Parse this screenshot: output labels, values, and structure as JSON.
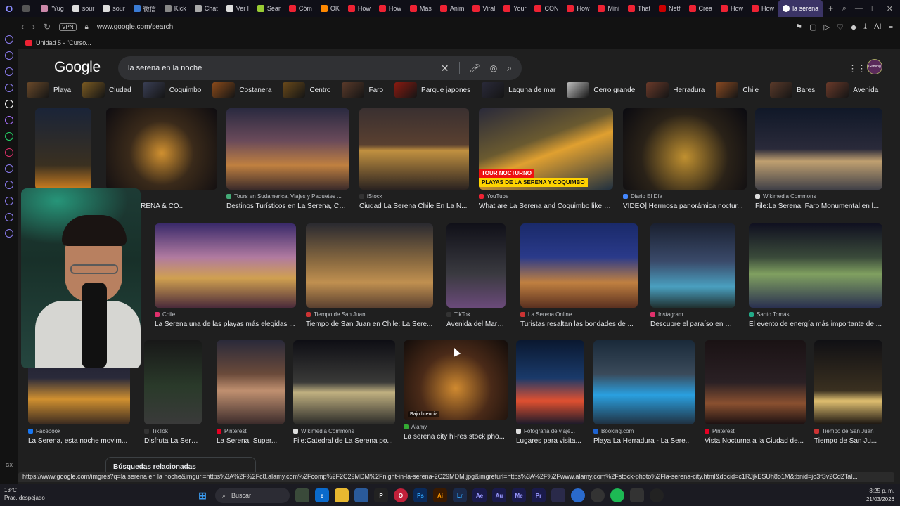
{
  "tabs": [
    {
      "label": "",
      "color": "#555"
    },
    {
      "label": "\"Yug",
      "color": "#c8a"
    },
    {
      "label": "sour",
      "color": "#ddd"
    },
    {
      "label": "sour",
      "color": "#ddd"
    },
    {
      "label": "微信",
      "color": "#3a7bd5"
    },
    {
      "label": "Kick",
      "color": "#888"
    },
    {
      "label": "Chat",
      "color": "#aaa"
    },
    {
      "label": "Ver l",
      "color": "#ddd"
    },
    {
      "label": "Sear",
      "color": "#9c3"
    },
    {
      "label": "Cóm",
      "color": "#e23"
    },
    {
      "label": "OK",
      "color": "#f80"
    },
    {
      "label": "How",
      "color": "#e23"
    },
    {
      "label": "How",
      "color": "#e23"
    },
    {
      "label": "Mas",
      "color": "#e23"
    },
    {
      "label": "Anim",
      "color": "#e23"
    },
    {
      "label": "Viral",
      "color": "#e23"
    },
    {
      "label": "Your",
      "color": "#e23"
    },
    {
      "label": "CON",
      "color": "#e23"
    },
    {
      "label": "How",
      "color": "#e23"
    },
    {
      "label": "Mini",
      "color": "#e23"
    },
    {
      "label": "That",
      "color": "#e23"
    },
    {
      "label": "Netf",
      "color": "#c00"
    },
    {
      "label": "Crea",
      "color": "#e23"
    },
    {
      "label": "How",
      "color": "#e23"
    },
    {
      "label": "How",
      "color": "#e23"
    }
  ],
  "active_tab": "la serena",
  "address": {
    "vpn": "VPN",
    "url": "www.google.com/search"
  },
  "bookmark": "Unidad 5 - \"Curso...",
  "search": {
    "logo": "Google",
    "query": "la serena en la noche"
  },
  "avatar_text": "Gaming",
  "chips": [
    {
      "label": "Playa",
      "color": "#6b4a2a"
    },
    {
      "label": "Ciudad",
      "color": "#7a5a22"
    },
    {
      "label": "Coquimbo",
      "color": "#3a3f55"
    },
    {
      "label": "Costanera",
      "color": "#8a4a1a"
    },
    {
      "label": "Centro",
      "color": "#6a4a1a"
    },
    {
      "label": "Faro",
      "color": "#5a3a2a"
    },
    {
      "label": "Parque japones",
      "color": "#8a1a10"
    },
    {
      "label": "Laguna de mar",
      "color": "#2a2a3a"
    },
    {
      "label": "Cerro grande",
      "color": "#c0c0c0"
    },
    {
      "label": "Herradura",
      "color": "#6a3a2a"
    },
    {
      "label": "Chile",
      "color": "#8a4a22"
    },
    {
      "label": "Bares",
      "color": "#5a3a2a"
    },
    {
      "label": "Avenida",
      "color": "#6a3a2a"
    }
  ],
  "results": [
    {
      "source": "",
      "title": "",
      "bg": "linear-gradient(180deg,#1a2438,#3a3020 70%,#d08020)"
    },
    {
      "source": "ture.com",
      "title": "ON \"LA SERENA & CO...",
      "bg": "radial-gradient(circle at 50% 55%,#d09030 0%,#3a2a1a 45%,#0e0c10 100%)"
    },
    {
      "source": "Tours en Sudamerica, Viajes y Paquetes ...",
      "title": "Destinos Turísticos en La Serena, Chile",
      "bg": "linear-gradient(180deg,#2a2a40,#6a4a5a 40%,#c08040 70%,#3a2a2a)"
    },
    {
      "source": "iStock",
      "title": "Ciudad La Serena Chile En La N...",
      "bg": "linear-gradient(180deg,#3a3030,#5a4030 45%,#c09040 52%,#2a2220)"
    },
    {
      "source": "YouTube",
      "title": "What are La Serena and Coquimbo like a...",
      "bg": "linear-gradient(160deg,#2a2a3a,#6a5a30 40%,#e0a030 55%,#203040)"
    },
    {
      "source": "Diario El Día",
      "title": "VIDEO] Hermosa panorámica noctur...",
      "bg": "radial-gradient(circle at 50% 60%,#c09030 0%,#2a2218 55%,#0a0a10 100%)"
    },
    {
      "source": "Wikimedia Commons",
      "title": "File:La Serena, Faro Monumental en l...",
      "bg": "linear-gradient(180deg,#101828,#2a2a3a 50%,#c0a070 65%,#404048)"
    },
    {
      "source": "Chile",
      "title": "La Serena una de las playas más elegidas ...",
      "bg": "linear-gradient(180deg,#3a2a6a,#b07aa0 40%,#d0a050 65%,#4a2a3a)"
    },
    {
      "source": "Tiempo de San Juan",
      "title": "Tiempo de San Juan en Chile: La Sere...",
      "bg": "linear-gradient(180deg,#2a2a30,#8a6a40 45%,#c09050 70%,#5a4030)"
    },
    {
      "source": "TikTok",
      "title": "Avenida del Mar: U...",
      "bg": "linear-gradient(180deg,#101018,#3a3a40 60%,#6a4a7a)"
    },
    {
      "source": "La Serena Online",
      "title": "Turistas resaltan las bondades de ...",
      "bg": "linear-gradient(180deg,#1a2a6a,#2a3a8a 40%,#c08040 70%,#5a3020)"
    },
    {
      "source": "Instagram",
      "title": "Descubre el paraíso en La ...",
      "bg": "linear-gradient(180deg,#1a2030,#3a4a6a 45%,#4aa0c0 75%,#203030)"
    },
    {
      "source": "Santo Tomás",
      "title": "El evento de energía más importante de ...",
      "bg": "linear-gradient(180deg,#101020,#3a4a3a 40%,#80a060 60%,#2a3050)"
    },
    {
      "source": "Facebook",
      "title": "La Serena, esta noche movim...",
      "bg": "linear-gradient(180deg,#1a1a2a,#2a2a3a 45%,#d09030 70%,#3a2a20)"
    },
    {
      "source": "TikTok",
      "title": "Disfruta La Serena...",
      "bg": "linear-gradient(180deg,#181818,#2a3a2a 55%,#3a3a3a)"
    },
    {
      "source": "Pinterest",
      "title": "La Serena, Super...",
      "bg": "linear-gradient(180deg,#2a2a3a,#6a4a3a 40%,#c09070 60%,#3a2a2a)"
    },
    {
      "source": "Wikimedia Commons",
      "title": "File:Catedral de La Serena po...",
      "bg": "linear-gradient(180deg,#0e0e14,#3a3a38 50%,#c0b080 62%,#2a2a28)"
    },
    {
      "source": "Alamy",
      "title": "La serena city hi-res stock pho...",
      "bg": "radial-gradient(circle at 50% 60%,#d08a30 0%,#4a2a18 50%,#120c0a 100%)"
    },
    {
      "source": "Fotografía de viaje...",
      "title": "Lugares para visita...",
      "bg": "linear-gradient(180deg,#0a1830,#1a3a6a 45%,#e05030 72%,#1a1a2a)"
    },
    {
      "source": "Booking.com",
      "title": "Playa La Herradura - La Sere...",
      "bg": "linear-gradient(180deg,#1a2a3a,#3a4a5a 40%,#2aa0e0 65%,#203040)"
    },
    {
      "source": "Pinterest",
      "title": "Vista Nocturna a la Ciudad de...",
      "bg": "linear-gradient(180deg,#1a1214,#2a2024 50%,#8a5030 75%,#1a1012)"
    },
    {
      "source": "Tiempo de San Juan",
      "title": "Tiempo de San Ju...",
      "bg": "linear-gradient(180deg,#101014,#3a3020 60%,#e0c070 72%,#1a1410)"
    }
  ],
  "labels": {
    "tour_top": "TOUR NOCTURNO",
    "tour_bottom": "PLAYAS DE LA SERENA Y COQUIMBO",
    "license": "Bajo licencia",
    "related": "Búsquedas relacionadas"
  },
  "status_url": "https://www.google.com/imgres?q=la serena en la noche&imgurl=https%3A%2F%2Fc8.alamy.com%2Fcomp%2F2C29MDM%2Fnight-in-la-serena-2C29MDM.jpg&imgrefurl=https%3A%2F%2Fwww.alamy.com%2Fstock-photo%2Fla-serena-city.html&docid=c1RJjkESUh8o1M&tbnid=jo3fSv2Cd2Tal...",
  "taskbar": {
    "temp": "13°C",
    "weather": "Prac. despejado",
    "search": "Buscar",
    "time": "8:25 p. m.",
    "date": "21/03/2026"
  },
  "sidebar_label": "GX"
}
